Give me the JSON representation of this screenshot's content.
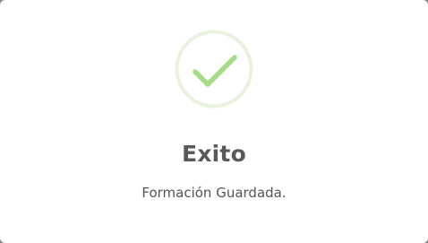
{
  "dialog": {
    "icon": "success-check-icon",
    "title": "Exito",
    "message": "Formación Guardada."
  },
  "colors": {
    "success_ring": "#e7f3df",
    "success_check": "#a5dc86",
    "title_text": "#595959",
    "message_text": "#545454",
    "background": "#ffffff",
    "overlay": "#8a8a8a"
  }
}
